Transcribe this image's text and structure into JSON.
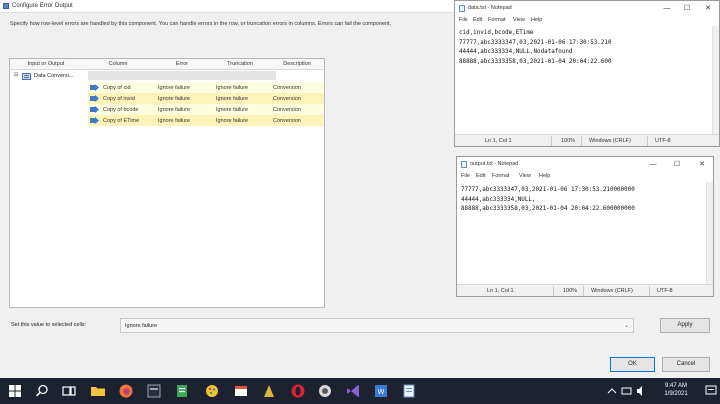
{
  "dialog": {
    "title": "Configure Error Output",
    "description": "Specify how row-level errors are handled by this component. You can handle errors in the row, or truncation errors in columns. Errors can fail the component,",
    "columns": [
      "Input or Output",
      "Column",
      "Error",
      "Truncation",
      "Description"
    ],
    "tree_item": {
      "toggle": "⊟",
      "label": "Data Conversi..."
    },
    "rows": [
      {
        "column": "Copy of cid",
        "error": "Ignore failure",
        "truncation": "Ignore failure",
        "description": "Conversion"
      },
      {
        "column": "Copy of invid",
        "error": "Ignore failure",
        "truncation": "Ignore failure",
        "description": "Conversion"
      },
      {
        "column": "Copy of bcode",
        "error": "Ignore failure",
        "truncation": "Ignore failure",
        "description": "Conversion"
      },
      {
        "column": "Copy of ETime",
        "error": "Ignore failure",
        "truncation": "Ignore failure",
        "description": "Conversion"
      }
    ],
    "set_value_label": "Set this value to selected cells:",
    "set_value": "Ignore failure",
    "apply_label": "Apply",
    "ok_label": "OK",
    "cancel_label": "Cancel"
  },
  "notepad_data": {
    "title": "data.txt - Notepad",
    "menu": [
      "File",
      "Edit",
      "Format",
      "View",
      "Help"
    ],
    "lines": [
      "cid,invid,bcode,ETime",
      "77777,abc3333347,03,2021-01-06 17:30:53.210",
      "44444,abc333334,NULL,Nodatafound",
      "88888,abc3333358,03,2021-01-04 20:04:22.600"
    ],
    "status": {
      "position": "Ln 1, Col 1",
      "zoom": "100%",
      "line_ending": "Windows (CRLF)",
      "encoding": "UTF-8"
    }
  },
  "notepad_output": {
    "title": "output.txt - Notepad",
    "menu": [
      "File",
      "Edit",
      "Format",
      "View",
      "Help"
    ],
    "lines": [
      "77777,abc3333347,03,2021-01-06 17:30:53.210000000",
      "44444,abc333334,NULL,",
      "88888,abc3333358,03,2021-01-04 20:04:22.600000000"
    ],
    "status": {
      "position": "Ln 1, Col 1",
      "zoom": "100%",
      "line_ending": "Windows (CRLF)",
      "encoding": "UTF-8"
    }
  },
  "window_controls": {
    "minimize": "—",
    "maximize": "☐",
    "close": "✕"
  },
  "taskbar": {
    "apps": [
      "start-icon",
      "search-icon",
      "task-view-icon",
      "file-explorer-icon",
      "firefox-icon",
      "app-icon",
      "sticky-notes-icon",
      "paint-icon",
      "app-icon",
      "opera-icon",
      "app-icon",
      "visual-studio-icon",
      "app-icon",
      "notepad-icon"
    ],
    "time": "9:47 AM",
    "date": "1/9/2021"
  },
  "colors": {
    "title_accent": "#0078d7",
    "row_highlight": "#fdf3b8",
    "taskbar": "#1c2230"
  }
}
